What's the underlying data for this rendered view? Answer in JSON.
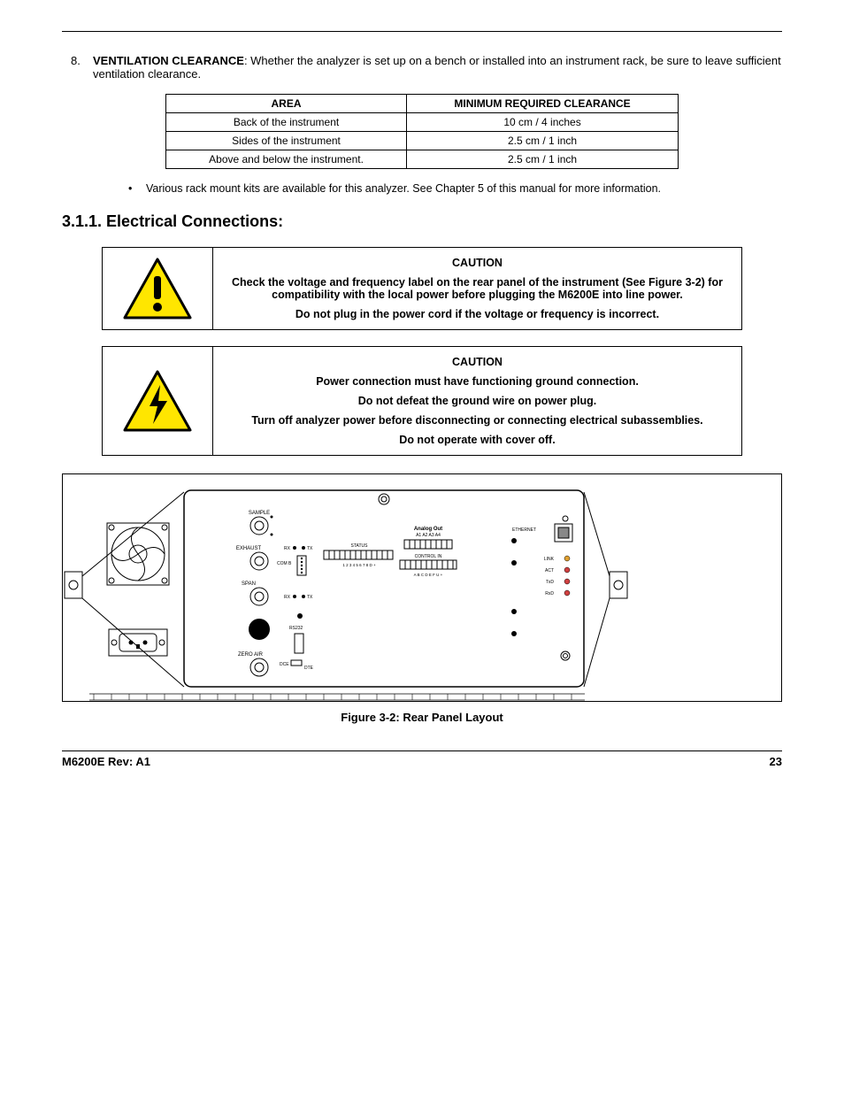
{
  "list": {
    "number": "8.",
    "lead": "VENTILATION CLEARANCE",
    "body": ": Whether the analyzer is set up on a bench or installed into an instrument rack, be sure to leave sufficient ventilation clearance."
  },
  "table": {
    "headers": [
      "AREA",
      "MINIMUM REQUIRED CLEARANCE"
    ],
    "rows": [
      [
        "Back of the instrument",
        "10 cm / 4 inches"
      ],
      [
        "Sides of the instrument",
        "2.5 cm / 1 inch"
      ],
      [
        "Above and below the instrument.",
        "2.5 cm / 1 inch"
      ]
    ]
  },
  "bullet": "Various rack mount kits are available for this analyzer. See Chapter 5 of this manual for more information.",
  "section_heading": "3.1.1. Electrical Connections:",
  "caution1": {
    "title": "CAUTION",
    "p1": "Check the voltage and frequency label on the rear panel of the instrument (See Figure 3-2) for compatibility with the local power before plugging the M6200E into line power.",
    "p2": "Do not plug in the power cord if the voltage or frequency is incorrect."
  },
  "caution2": {
    "title": "CAUTION",
    "p1": "Power connection must have functioning ground connection.",
    "p2": "Do not defeat the ground wire on power plug.",
    "p3": "Turn off analyzer power before disconnecting or connecting electrical subassemblies.",
    "p4": "Do not operate with cover off."
  },
  "figure": {
    "panel_labels": {
      "sample": "SAMPLE",
      "exhaust": "EXHAUST",
      "span": "SPAN",
      "zero_air": "ZERO AIR",
      "com_b": "COM B",
      "rs232": "RS232",
      "rx": "RX",
      "tx": "TX",
      "status": "STATUS",
      "analog_out": "Analog Out",
      "analog_channels": "A1 A2 A3 A4",
      "control_in": "CONTROL IN",
      "status_nums": "1 2 3 4 5 6 7 8 D   +",
      "control_letters": "A B C D E F   U  +",
      "dce": "DCE",
      "dte": "DTE",
      "ethernet": "ETHERNET",
      "link": "LINK",
      "act": "ACT",
      "txd": "TxD",
      "rxd": "RxD"
    },
    "caption": "Figure 3-2:    Rear Panel Layout"
  },
  "footer": {
    "left": "M6200E Rev: A1",
    "right": "23"
  }
}
